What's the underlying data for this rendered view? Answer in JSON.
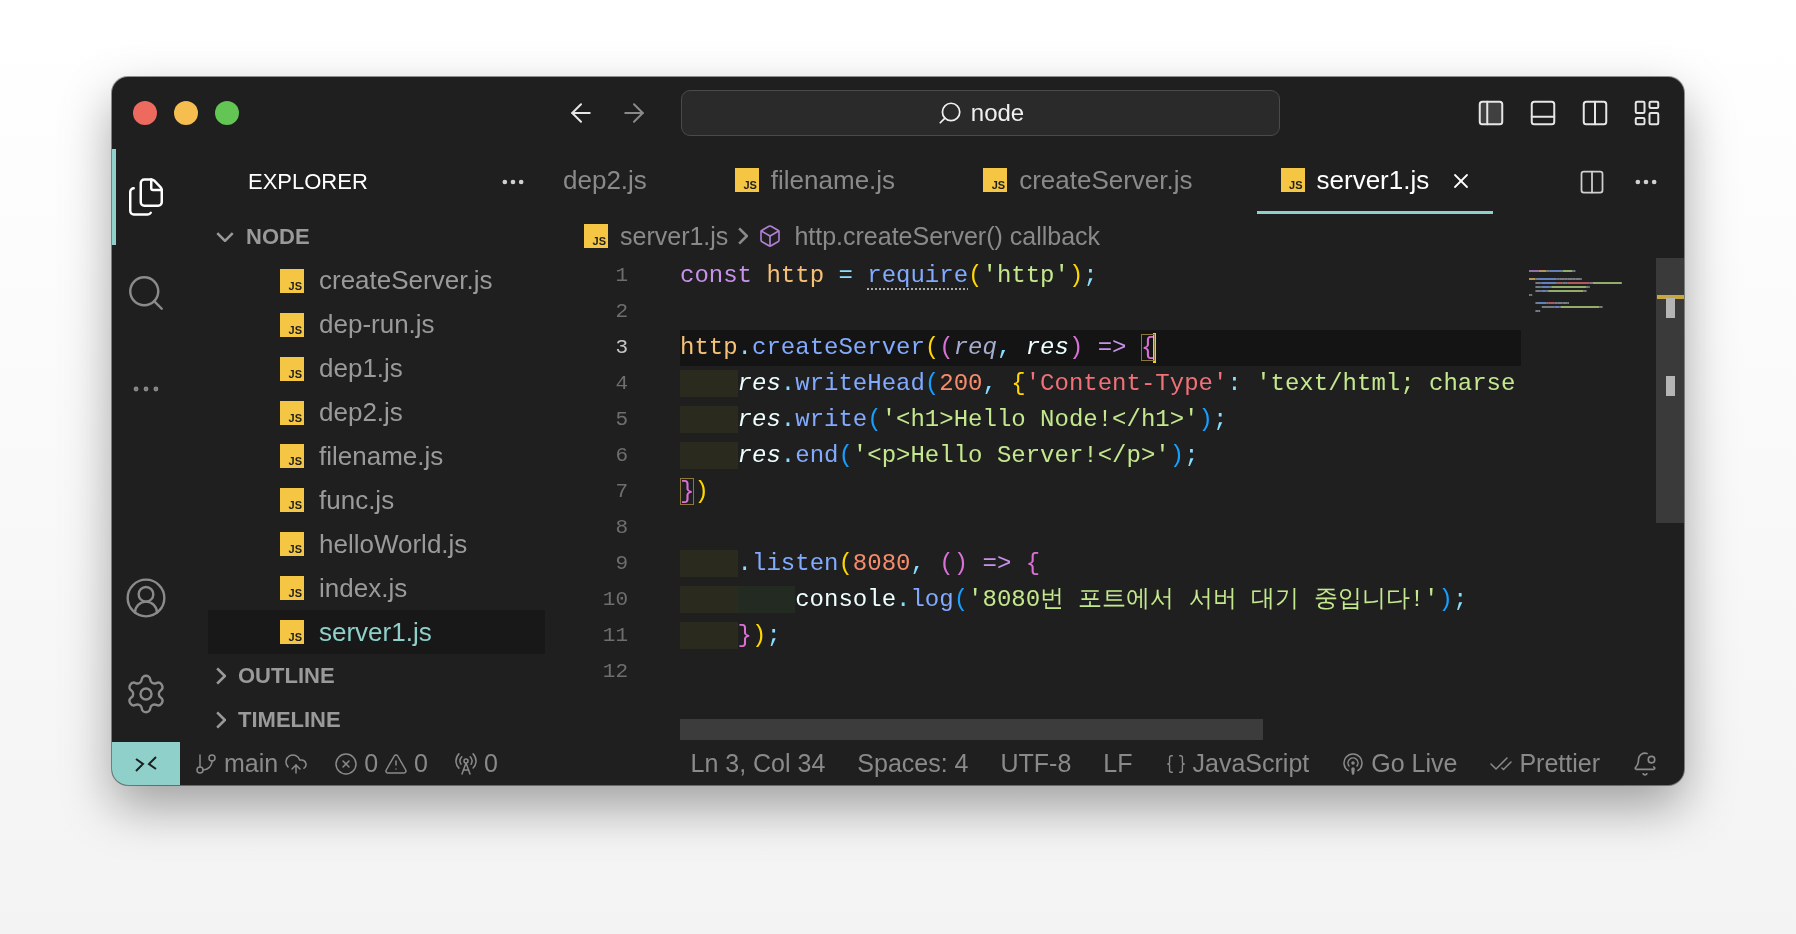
{
  "title_bar": {
    "search": {
      "value": "node"
    }
  },
  "activity_bar": {
    "items": [
      {
        "kind": "files",
        "selected": true
      },
      {
        "kind": "search",
        "selected": false
      },
      {
        "kind": "more",
        "selected": false
      }
    ],
    "bottom": [
      {
        "kind": "account"
      },
      {
        "kind": "settings"
      }
    ]
  },
  "sidebar": {
    "title": "EXPLORER",
    "sections": [
      {
        "label": "NODE",
        "expanded": true,
        "items": [
          {
            "name": "createServer.js",
            "icon": "JS",
            "selected": false
          },
          {
            "name": "dep-run.js",
            "icon": "JS",
            "selected": false
          },
          {
            "name": "dep1.js",
            "icon": "JS",
            "selected": false
          },
          {
            "name": "dep2.js",
            "icon": "JS",
            "selected": false
          },
          {
            "name": "filename.js",
            "icon": "JS",
            "selected": false
          },
          {
            "name": "func.js",
            "icon": "JS",
            "selected": false
          },
          {
            "name": "helloWorld.js",
            "icon": "JS",
            "selected": false
          },
          {
            "name": "index.js",
            "icon": "JS",
            "selected": false
          },
          {
            "name": "server1.js",
            "icon": "JS",
            "selected": true
          }
        ]
      },
      {
        "label": "OUTLINE",
        "expanded": false
      },
      {
        "label": "TIMELINE",
        "expanded": false
      }
    ]
  },
  "tabs": [
    {
      "label": "dep2.js",
      "selected": false
    },
    {
      "label": "filename.js",
      "icon": "JS",
      "selected": false
    },
    {
      "label": "createServer.js",
      "icon": "JS",
      "selected": false
    },
    {
      "label": "server1.js",
      "icon": "JS",
      "selected": true
    }
  ],
  "breadcrumb": [
    {
      "kind": "file",
      "icon": "JS",
      "text": "server1.js"
    },
    {
      "kind": "symbol",
      "text": "http.createServer() callback"
    }
  ],
  "editor": {
    "lines": [
      {
        "number": "1",
        "current": false,
        "tokens": [
          {
            "kind": "kw",
            "text": "const "
          },
          {
            "kind": "var",
            "text": "http "
          },
          {
            "kind": "punct",
            "text": "= "
          },
          {
            "kind": "fn",
            "text": "require",
            "hint": true
          },
          {
            "kind": "p1",
            "text": "("
          },
          {
            "kind": "str",
            "text": "'http'"
          },
          {
            "kind": "p1",
            "text": ")"
          },
          {
            "kind": "punct",
            "text": ";"
          }
        ]
      },
      {
        "number": "2",
        "current": false
      },
      {
        "number": "3",
        "current": true,
        "tokens": [
          {
            "kind": "var",
            "text": "http"
          },
          {
            "kind": "punct",
            "text": "."
          },
          {
            "kind": "fn",
            "text": "createServer"
          },
          {
            "kind": "p1",
            "text": "("
          },
          {
            "kind": "p2",
            "text": "("
          },
          {
            "kind": "param-dim",
            "text": "req"
          },
          {
            "kind": "punct",
            "text": ", "
          },
          {
            "kind": "param",
            "text": "res"
          },
          {
            "kind": "p2",
            "text": ") "
          },
          {
            "kind": "op",
            "text": "=> "
          },
          {
            "kind": "p2",
            "text": "{",
            "boxed": true
          }
        ]
      },
      {
        "number": "4",
        "current": false,
        "guides": [
          {
            "kind": "outer"
          }
        ],
        "tokens": [
          {
            "kind": "param",
            "text": "res"
          },
          {
            "kind": "punct",
            "text": "."
          },
          {
            "kind": "fn",
            "text": "writeHead"
          },
          {
            "kind": "p3",
            "text": "("
          },
          {
            "kind": "num",
            "text": "200"
          },
          {
            "kind": "punct",
            "text": ", "
          },
          {
            "kind": "p1",
            "text": "{"
          },
          {
            "kind": "key",
            "text": "'Content-Type'"
          },
          {
            "kind": "punct",
            "text": ": "
          },
          {
            "kind": "str",
            "text": "'text/html; charse"
          }
        ]
      },
      {
        "number": "5",
        "current": false,
        "guides": [
          {
            "kind": "outer"
          }
        ],
        "tokens": [
          {
            "kind": "param",
            "text": "res"
          },
          {
            "kind": "punct",
            "text": "."
          },
          {
            "kind": "fn",
            "text": "write"
          },
          {
            "kind": "p3",
            "text": "("
          },
          {
            "kind": "str",
            "text": "'<h1>Hello Node!</h1>'"
          },
          {
            "kind": "p3",
            "text": ")"
          },
          {
            "kind": "punct",
            "text": ";"
          }
        ]
      },
      {
        "number": "6",
        "current": false,
        "guides": [
          {
            "kind": "outer"
          }
        ],
        "tokens": [
          {
            "kind": "param",
            "text": "res"
          },
          {
            "kind": "punct",
            "text": "."
          },
          {
            "kind": "fn",
            "text": "end"
          },
          {
            "kind": "p3",
            "text": "("
          },
          {
            "kind": "str",
            "text": "'<p>Hello Server!</p>'"
          },
          {
            "kind": "p3",
            "text": ")"
          },
          {
            "kind": "punct",
            "text": ";"
          }
        ]
      },
      {
        "number": "7",
        "current": false,
        "tokens": [
          {
            "kind": "p2",
            "text": "}",
            "boxed": true
          },
          {
            "kind": "p1",
            "text": ")"
          }
        ]
      },
      {
        "number": "8",
        "current": false
      },
      {
        "number": "9",
        "current": false,
        "guides": [
          {
            "kind": "outer"
          }
        ],
        "tokens": [
          {
            "kind": "punct",
            "text": "."
          },
          {
            "kind": "fn",
            "text": "listen"
          },
          {
            "kind": "p1",
            "text": "("
          },
          {
            "kind": "num",
            "text": "8080"
          },
          {
            "kind": "punct",
            "text": ", "
          },
          {
            "kind": "p2",
            "text": "() "
          },
          {
            "kind": "op",
            "text": "=> "
          },
          {
            "kind": "p2",
            "text": "{"
          }
        ]
      },
      {
        "number": "10",
        "current": false,
        "guides": [
          {
            "kind": "outer"
          },
          {
            "kind": "inner"
          }
        ],
        "tokens": [
          {
            "kind": "plain",
            "text": "console"
          },
          {
            "kind": "punct",
            "text": "."
          },
          {
            "kind": "fn",
            "text": "log"
          },
          {
            "kind": "p3",
            "text": "("
          },
          {
            "kind": "str",
            "text": "'8080번 포트에서 서버 대기 중입니다!'"
          },
          {
            "kind": "p3",
            "text": ")"
          },
          {
            "kind": "punct",
            "text": ";"
          }
        ]
      },
      {
        "number": "11",
        "current": false,
        "guides": [
          {
            "kind": "outer"
          }
        ],
        "tokens": [
          {
            "kind": "p2",
            "text": "}"
          },
          {
            "kind": "p1",
            "text": ")"
          },
          {
            "kind": "punct",
            "text": ";"
          }
        ]
      },
      {
        "number": "12",
        "current": false
      }
    ]
  },
  "status_bar": {
    "branch": "main",
    "errors": "0",
    "warnings": "0",
    "ports": "0",
    "items": [
      {
        "kind": "text",
        "text": "Ln 3, Col 34"
      },
      {
        "kind": "text",
        "text": "Spaces: 4"
      },
      {
        "kind": "text",
        "text": "UTF-8"
      },
      {
        "kind": "text",
        "text": "LF"
      },
      {
        "kind": "language",
        "text": "JavaScript"
      },
      {
        "kind": "live",
        "text": "Go Live"
      },
      {
        "kind": "prettier",
        "text": "Prettier"
      },
      {
        "kind": "bell"
      }
    ]
  }
}
